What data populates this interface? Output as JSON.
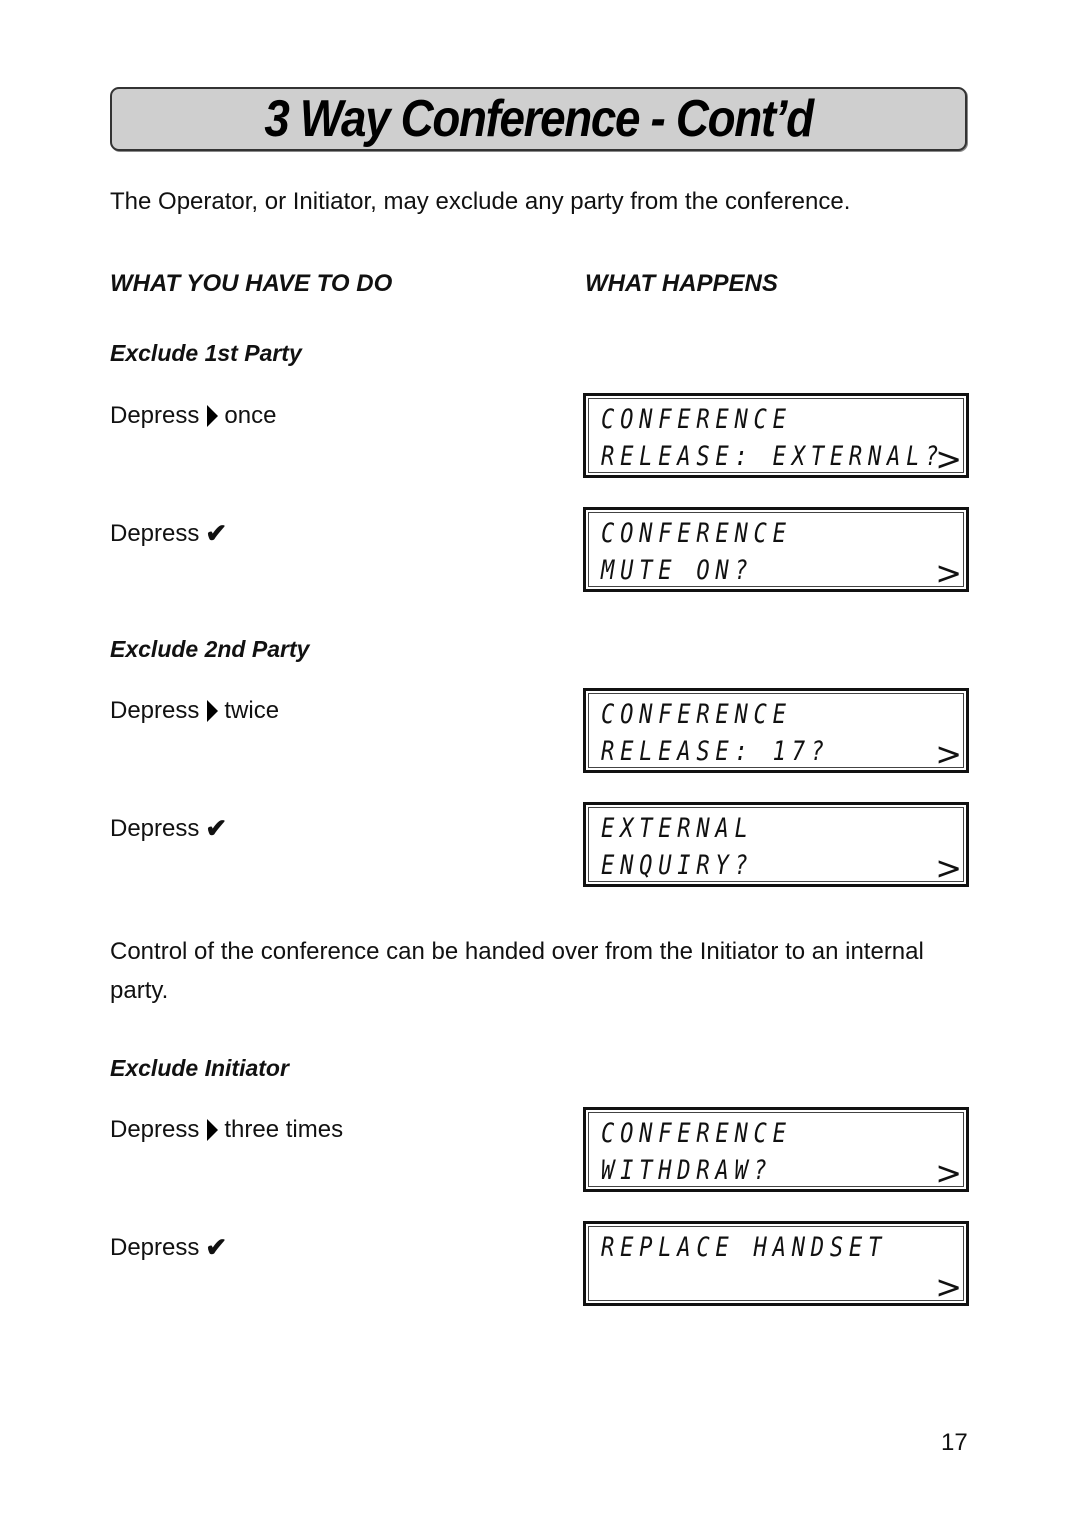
{
  "title": "3 Way Conference - Cont’d",
  "intro": "The Operator, or Initiator, may exclude any party from the conference.",
  "columns": {
    "left": "WHAT YOU HAVE TO DO",
    "right": "WHAT HAPPENS"
  },
  "sections": [
    {
      "heading": "Exclude 1st Party",
      "steps": [
        {
          "prefix": "Depress",
          "icon": "right-arrow-key",
          "suffix": "once",
          "display": [
            "CONFERENCE",
            "RELEASE: EXTERNAL?"
          ],
          "arrow": ">"
        },
        {
          "prefix": "Depress",
          "icon": "check-key",
          "suffix": "✔",
          "display": [
            "CONFERENCE",
            "MUTE ON?"
          ],
          "arrow": ">"
        }
      ]
    },
    {
      "heading": "Exclude 2nd Party",
      "steps": [
        {
          "prefix": "Depress",
          "icon": "right-arrow-key",
          "suffix": "twice",
          "display": [
            "CONFERENCE",
            "RELEASE: 17?"
          ],
          "arrow": ">"
        },
        {
          "prefix": "Depress",
          "icon": "check-key",
          "suffix": "✔",
          "display": [
            "EXTERNAL",
            "ENQUIRY?"
          ],
          "arrow": ">"
        }
      ]
    },
    {
      "heading": "Exclude Initiator",
      "steps": [
        {
          "prefix": "Depress",
          "icon": "right-arrow-key",
          "suffix": "three times",
          "display": [
            "CONFERENCE",
            "WITHDRAW?"
          ],
          "arrow": ">"
        },
        {
          "prefix": "Depress",
          "icon": "check-key",
          "suffix": "✔",
          "display": [
            "REPLACE HANDSET",
            ""
          ],
          "arrow": ">"
        }
      ]
    }
  ],
  "handover_text": "Control of the conference can be handed over from the Initiator to an internal party.",
  "page_number": "17"
}
